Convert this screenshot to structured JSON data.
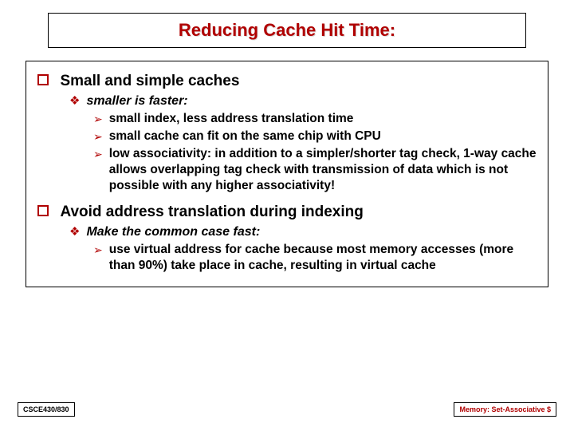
{
  "title": "Reducing Cache Hit Time:",
  "sections": [
    {
      "heading": "Small and simple caches",
      "sub": [
        {
          "text": "smaller is faster:",
          "items": [
            "small index, less address translation time",
            " small cache can fit on the same chip with CPU",
            "low associativity: in addition to a simpler/shorter tag check, 1-way cache allows overlapping tag check with transmission of data which is not possible with any higher associativity!"
          ]
        }
      ]
    },
    {
      "heading": "Avoid address translation during indexing",
      "sub": [
        {
          "text": "Make the common case fast:",
          "items": [
            "use virtual address for cache because most memory accesses (more than 90%) take place in cache, resulting in virtual cache"
          ]
        }
      ]
    }
  ],
  "footer": {
    "left": "CSCE430/830",
    "right": "Memory: Set-Associative $"
  }
}
